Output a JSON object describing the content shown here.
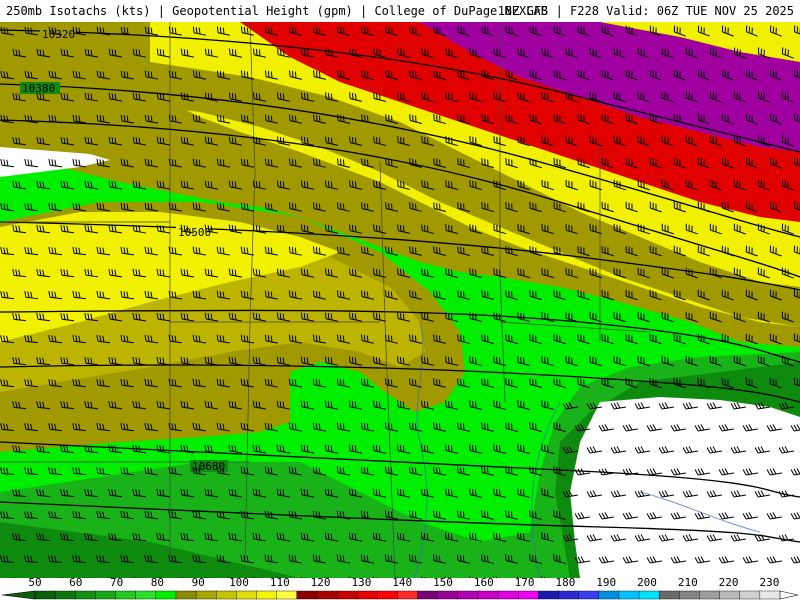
{
  "header": {
    "left_title": "250mb Isotachs (kts) | Geopotential Height (gpm) | College of DuPage NEXLAB",
    "right_title": "18Z GFS | F228 Valid: 06Z TUE NOV 25 2025"
  },
  "contours": {
    "labels": [
      "10320",
      "10380",
      "10500",
      "10680"
    ]
  },
  "legend": {
    "tick_labels": [
      "50",
      "60",
      "70",
      "80",
      "90",
      "100",
      "110",
      "120",
      "130",
      "140",
      "150",
      "160",
      "170",
      "180",
      "190",
      "200",
      "210",
      "220",
      "230"
    ],
    "colors": [
      "#0b5e0b",
      "#0e750e",
      "#148f14",
      "#1aa81a",
      "#23c823",
      "#2ee02e",
      "#00f000",
      "#8a8a00",
      "#a6a600",
      "#c4c400",
      "#dede00",
      "#f5f500",
      "#ffff3a",
      "#8a0000",
      "#a80000",
      "#c80000",
      "#e60000",
      "#ff0000",
      "#ff2a2a",
      "#7a007a",
      "#960096",
      "#b000b0",
      "#c800c8",
      "#e000e0",
      "#f000f0",
      "#1a1ab0",
      "#2b2bd0",
      "#3c3cf0",
      "#0090e0",
      "#00c0ff",
      "#00e0ff",
      "#6a6a6a",
      "#848484",
      "#9e9e9e",
      "#b8b8b8",
      "#d0d0d0",
      "#e8e8e8"
    ]
  },
  "colors": {
    "green_dark": "#0e8a0e",
    "green_mid": "#19b319",
    "green_bright": "#00ee00",
    "olive": "#a09a00",
    "olive_light": "#bdb400",
    "yellow": "#f0f000",
    "red": "#e00000",
    "purple": "#a000a0",
    "white": "#ffffff"
  }
}
